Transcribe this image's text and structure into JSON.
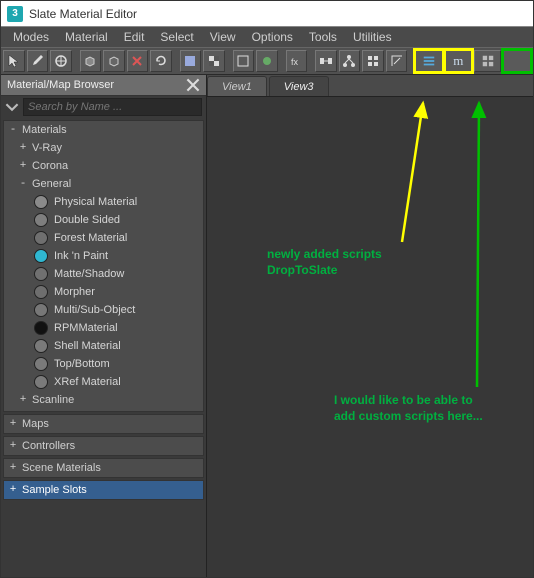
{
  "window": {
    "title": "Slate Material Editor",
    "app_icon_text": "3"
  },
  "menubar": [
    "Modes",
    "Material",
    "Edit",
    "Select",
    "View",
    "Options",
    "Tools",
    "Utilities"
  ],
  "toolbar": {
    "icons": [
      "cursor-icon",
      "eyedropper-icon",
      "assign-icon",
      "sep",
      "cube-icon",
      "cube2-icon",
      "delete-icon",
      "refresh-icon",
      "sep",
      "show-bg-icon",
      "checker-icon",
      "sep",
      "wire-icon",
      "render-icon",
      "sep",
      "fx-icon",
      "sep",
      "layout-h-icon",
      "layout-tree-icon",
      "layout-grid-icon",
      "layout-auto-icon",
      "sep"
    ],
    "extra": [
      {
        "name": "drop-to-slate-icon",
        "label": "≣",
        "highlight": "yellow"
      },
      {
        "name": "mscript-icon",
        "label": "m",
        "highlight": "yellow"
      },
      {
        "name": "grid-layout-icon",
        "label": "▦",
        "highlight": "none"
      },
      {
        "name": "empty-slot-icon",
        "label": "",
        "highlight": "green"
      }
    ]
  },
  "browser": {
    "title": "Material/Map Browser",
    "search_placeholder": "Search by Name ...",
    "groups": [
      {
        "label": "Materials",
        "state": "-",
        "children": [
          {
            "label": "V-Ray",
            "state": "+"
          },
          {
            "label": "Corona",
            "state": "+"
          },
          {
            "label": "General",
            "state": "-",
            "items": [
              {
                "label": "Physical Material",
                "swatch": "#8a8a8a"
              },
              {
                "label": "Double Sided",
                "swatch": "#7e7e7e"
              },
              {
                "label": "Forest Material",
                "swatch": "#6f6f6f"
              },
              {
                "label": "Ink 'n Paint",
                "swatch": "#2fb7d1"
              },
              {
                "label": "Matte/Shadow",
                "swatch": "#707070"
              },
              {
                "label": "Morpher",
                "swatch": "#6e6e6e"
              },
              {
                "label": "Multi/Sub-Object",
                "swatch": "#777777"
              },
              {
                "label": "RPMMaterial",
                "swatch": "#111111"
              },
              {
                "label": "Shell Material",
                "swatch": "#7a7a7a"
              },
              {
                "label": "Top/Bottom",
                "swatch": "#7a7a7a"
              },
              {
                "label": "XRef Material",
                "swatch": "#7a7a7a"
              }
            ]
          },
          {
            "label": "Scanline",
            "state": "+"
          }
        ]
      },
      {
        "label": "Maps",
        "state": "+"
      },
      {
        "label": "Controllers",
        "state": "+"
      },
      {
        "label": "Scene Materials",
        "state": "+"
      },
      {
        "label": "Sample Slots",
        "state": "+",
        "accent": true
      }
    ]
  },
  "tabs": [
    {
      "label": "View1",
      "active": false
    },
    {
      "label": "View3",
      "active": true
    }
  ],
  "annotations": {
    "note1_line1": "newly added scripts",
    "note1_line2": "DropToSlate",
    "note2_line1": "I would like to be able to",
    "note2_line2": "add custom scripts here..."
  },
  "colors": {
    "yellow": "#ffff00",
    "green": "#00c000"
  }
}
